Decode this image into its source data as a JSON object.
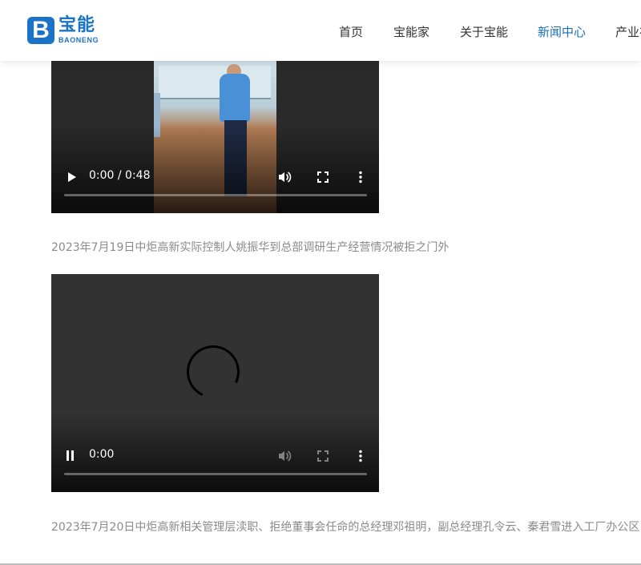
{
  "header": {
    "logo_cn": "宝能",
    "logo_en": "BAONENG",
    "logo_letter": "B",
    "brand_color": "#1a73c6",
    "nav": [
      {
        "label": "首页",
        "active": false
      },
      {
        "label": "宝能家",
        "active": false
      },
      {
        "label": "关于宝能",
        "active": false
      },
      {
        "label": "新闻中心",
        "active": true
      },
      {
        "label": "产业布局",
        "active": false
      }
    ]
  },
  "videos": [
    {
      "time": "0:00 / 0:48",
      "state": "paused",
      "icons": [
        "play-icon",
        "volume-icon",
        "fullscreen-icon",
        "more-options-icon"
      ]
    },
    {
      "time": "0:00",
      "state": "loading",
      "icons": [
        "pause-icon",
        "volume-icon",
        "fullscreen-icon",
        "more-options-icon"
      ]
    }
  ],
  "captions": [
    "2023年7月19日中炬高新实际控制人姚振华到总部调研生产经营情况被拒之门外",
    "2023年7月20日中炬高新相关管理层渎职、拒绝董事会任命的总经理邓祖明，副总经理孔令云、秦君雪进入工厂办公区"
  ]
}
